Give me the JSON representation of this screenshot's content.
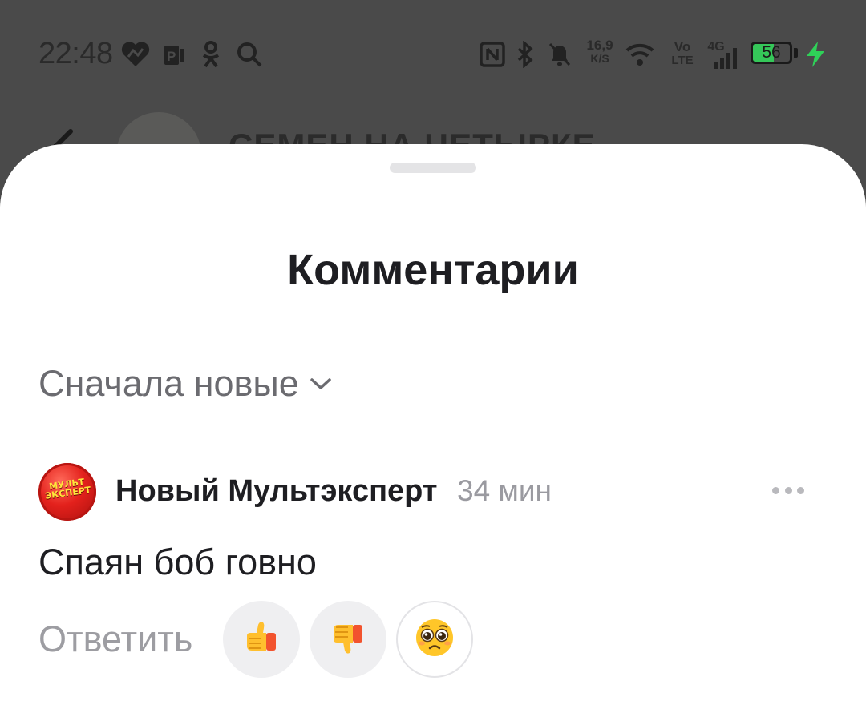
{
  "status_bar": {
    "time": "22:48",
    "speed_value": "16,9",
    "speed_unit": "K/S",
    "volte_top": "Vo",
    "volte_bottom": "LTE",
    "network": "4G",
    "battery_level": "56",
    "battery_percent": 56,
    "icons": [
      "heart-icon",
      "p-app-icon",
      "ok-icon",
      "search-icon",
      "nfc-icon",
      "bluetooth-icon",
      "bell-muted-icon",
      "wifi-icon",
      "signal-icon",
      "charging-icon"
    ]
  },
  "background_header": {
    "channel_title": "СЕМЕН НА ЧЕТЫРКЕ"
  },
  "sheet": {
    "title": "Комментарии",
    "sort_label": "Сначала новые",
    "comments": [
      {
        "avatar_text": "МУЛЬТ ЭКСПЕРТ",
        "author": "Новый Мультэксперт",
        "time": "34 мин",
        "text": "Спаян боб говно",
        "reply_label": "Ответить",
        "reactions": [
          "thumbs-up-icon",
          "thumbs-down-icon",
          "pleading-face-icon"
        ]
      }
    ]
  },
  "colors": {
    "overlay": "#4a4a4a",
    "sheet_bg": "#ffffff",
    "title_text": "#1e1e22",
    "muted_text": "#6b6b70",
    "meta_text": "#9a9aa0",
    "battery_green": "#35c759",
    "avatar_red": "#e3211c"
  }
}
